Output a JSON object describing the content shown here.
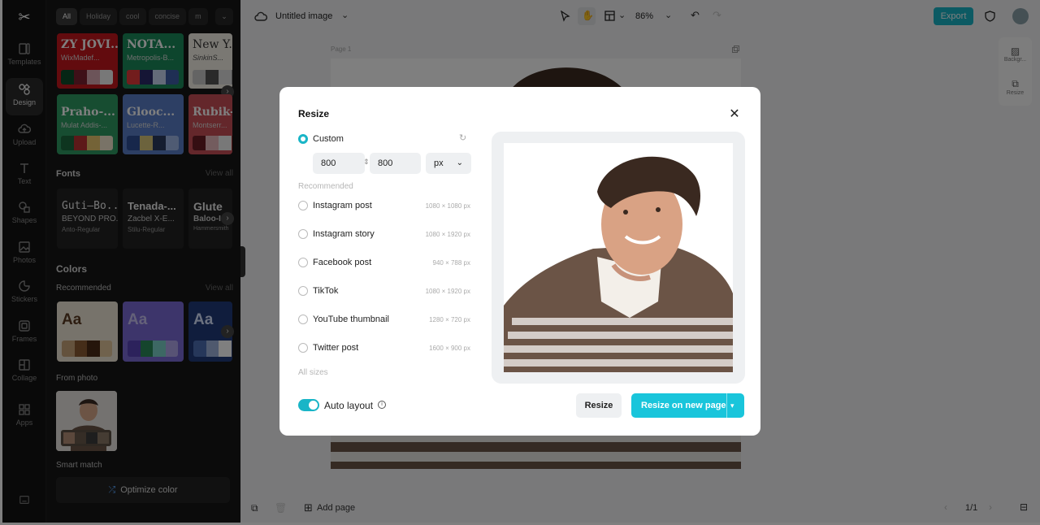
{
  "rail": {
    "items": [
      {
        "label": "Templates",
        "icon": "templates-icon"
      },
      {
        "label": "Design",
        "icon": "design-icon"
      },
      {
        "label": "Upload",
        "icon": "upload-icon"
      },
      {
        "label": "Text",
        "icon": "text-icon"
      },
      {
        "label": "Shapes",
        "icon": "shapes-icon"
      },
      {
        "label": "Photos",
        "icon": "photos-icon"
      },
      {
        "label": "Stickers",
        "icon": "stickers-icon"
      },
      {
        "label": "Frames",
        "icon": "frames-icon"
      },
      {
        "label": "Collage",
        "icon": "collage-icon"
      },
      {
        "label": "Apps",
        "icon": "apps-icon"
      }
    ]
  },
  "panel": {
    "chips": [
      "All",
      "Holiday",
      "cool",
      "concise",
      "m"
    ],
    "templates": [
      {
        "name": "ZY JOVI...",
        "sub": "WixMadef...",
        "bg": "#c4161c",
        "sw": [
          "#0d4d2a",
          "#7d2030",
          "#d9a8b2",
          "#f0f0f0"
        ]
      },
      {
        "name": "NOTA...",
        "sub": "Metropolis-B...",
        "bg": "#1b8a5a",
        "sw": [
          "#e53a3a",
          "#2a2a6a",
          "#c9d6f2",
          "#3e5fa8"
        ]
      },
      {
        "name": "New Y...",
        "sub": "SinkinS...",
        "bg": "#f4f0e6",
        "sw": [
          "#c8c8c8",
          "#555",
          "#ddd",
          "#999"
        ]
      },
      {
        "name": "Praho-...",
        "sub": "Mulat Addis-...",
        "bg": "#2f9a62",
        "sw": [
          "#1d6a3f",
          "#b33",
          "#e8c66f",
          "#f2e6cf"
        ]
      },
      {
        "name": "Glooc...",
        "sub": "Lucette-R...",
        "bg": "#5a7fc8",
        "sw": [
          "#2f4e97",
          "#d9c67a",
          "#2b3a5e",
          "#9fb7e6"
        ]
      },
      {
        "name": "Rubik-...",
        "sub": "Montserr...",
        "bg": "#c94f56",
        "sw": [
          "#6a1d25",
          "#e7b9bd",
          "#f0f0f0",
          "#a33"
        ]
      }
    ],
    "fonts_title": "Fonts",
    "fonts_viewall": "View all",
    "fonts": [
      {
        "name": "Guti–Bo...",
        "sample": "BEYOND PRO...",
        "sub": "Anto-Regular"
      },
      {
        "name": "Tenada-...",
        "sample": "Zacbel X-E...",
        "sub": "Stilu-Regular"
      },
      {
        "name": "Glute",
        "sample": "Baloo-I",
        "sub": "Hammersmith"
      }
    ],
    "colors_title": "Colors",
    "recommended_label": "Recommended",
    "colors_viewall": "View all",
    "color_cards": [
      {
        "aa": "Aa",
        "bg": "#efe6d6",
        "fg": "#5a3b22",
        "sw": [
          "#c9a47a",
          "#8a5a33",
          "#4a2a17",
          "#e1c49a"
        ]
      },
      {
        "aa": "Aa",
        "bg": "#7a6ad6",
        "fg": "#c9c2f2",
        "sw": [
          "#5845b8",
          "#2a8a5a",
          "#7ad0c8",
          "#b0a6ea"
        ]
      },
      {
        "aa": "Aa",
        "bg": "#213a7a",
        "fg": "#d6e2ff",
        "sw": [
          "#4c6fb5",
          "#9fb3dd",
          "#fff",
          "#2b3f73"
        ]
      }
    ],
    "from_photo_label": "From photo",
    "smart_match_label": "Smart match",
    "optimize_label": "Optimize color"
  },
  "topbar": {
    "title": "Untitled image",
    "zoom": "86%",
    "export_label": "Export"
  },
  "canvas": {
    "page_label": "Page 1"
  },
  "right_rail": {
    "background_label": "Backgr...",
    "resize_label": "Resize"
  },
  "bottombar": {
    "add_page_label": "Add page",
    "pages": "1/1"
  },
  "modal": {
    "title": "Resize",
    "custom_label": "Custom",
    "width": "800",
    "height": "800",
    "unit": "px",
    "recommended_label": "Recommended",
    "options": [
      {
        "label": "Instagram post",
        "size": "1080 × 1080 px"
      },
      {
        "label": "Instagram story",
        "size": "1080 × 1920 px"
      },
      {
        "label": "Facebook post",
        "size": "940 × 788 px"
      },
      {
        "label": "TikTok",
        "size": "1080 × 1920 px"
      },
      {
        "label": "YouTube thumbnail",
        "size": "1280 × 720 px"
      },
      {
        "label": "Twitter post",
        "size": "1600 × 900 px"
      }
    ],
    "all_sizes_label": "All sizes",
    "auto_layout_label": "Auto layout",
    "auto_layout_on": true,
    "resize_button": "Resize",
    "resize_new_button": "Resize on new page"
  },
  "colors": {
    "accent": "#19c5db",
    "export": "#19b5c7"
  }
}
